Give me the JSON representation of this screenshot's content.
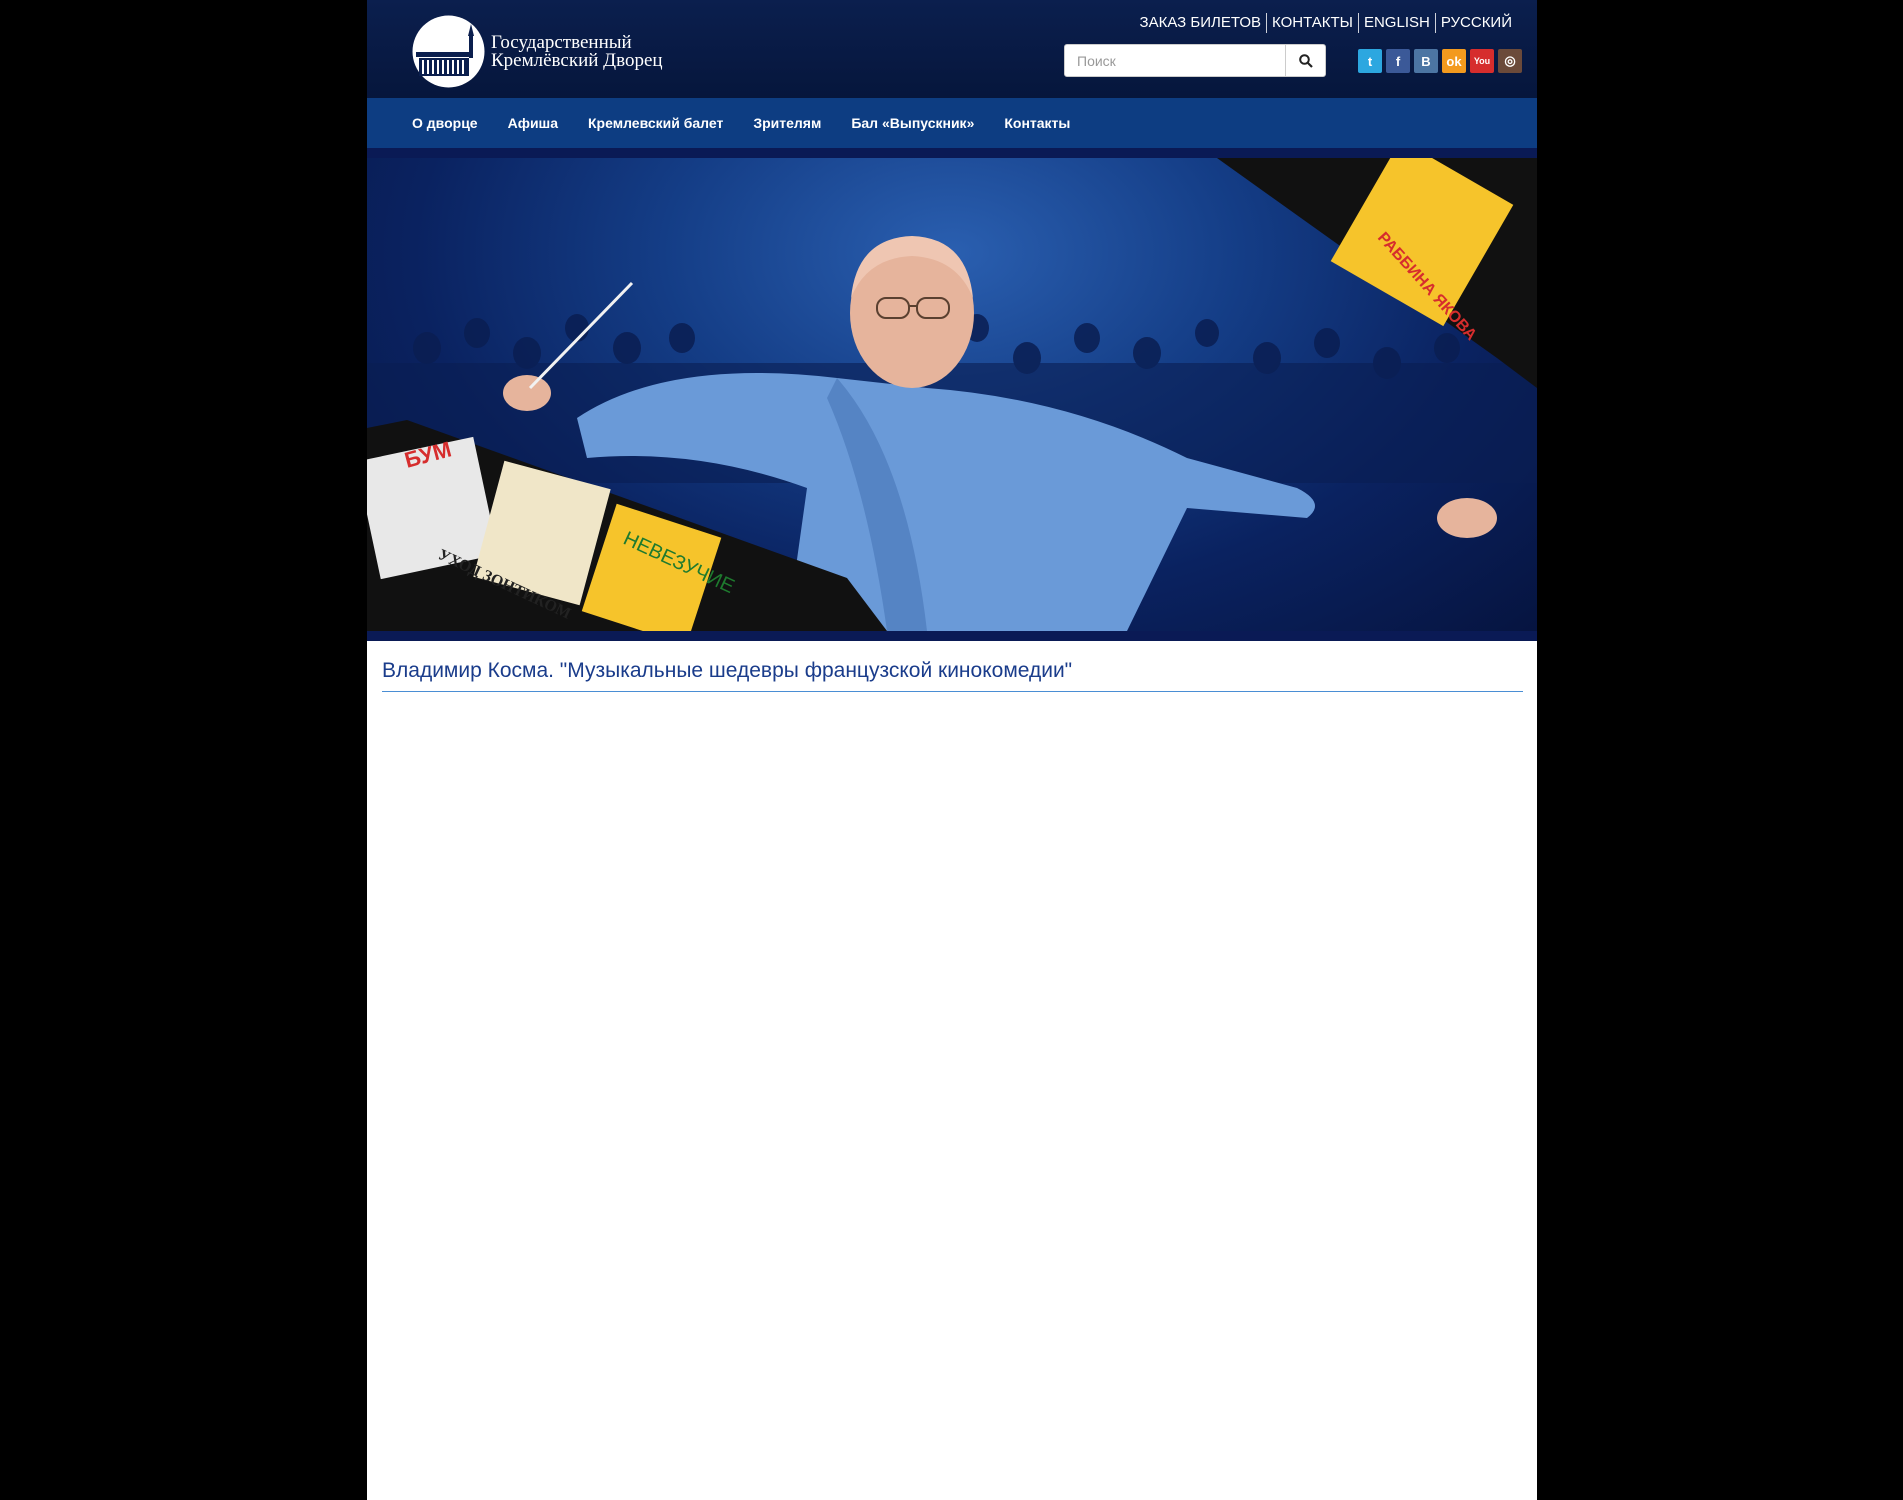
{
  "header": {
    "logo_line1": "Государственный",
    "logo_line2": "Кремлёвский Дворец",
    "top_links": [
      "ЗАКАЗ БИЛЕТОВ",
      "КОНТАКТЫ",
      "ENGLISH",
      "РУССКИЙ"
    ],
    "search": {
      "placeholder": "Поиск"
    },
    "social": [
      {
        "icon": "twitter-icon",
        "glyph": "t",
        "color": "#2ca7e0"
      },
      {
        "icon": "facebook-icon",
        "glyph": "f",
        "color": "#3b5998"
      },
      {
        "icon": "vk-icon",
        "glyph": "B",
        "color": "#4c75a3"
      },
      {
        "icon": "odnoklassniki-icon",
        "glyph": "ok",
        "color": "#f39a1e"
      },
      {
        "icon": "youtube-icon",
        "glyph": "You",
        "color": "#d62d2d"
      },
      {
        "icon": "instagram-icon",
        "glyph": "◎",
        "color": "#6b4a3a"
      }
    ]
  },
  "nav": {
    "items": [
      "О дворце",
      "Афиша",
      "Кремлевский балет",
      "Зрителям",
      "Бал «Выпускник»",
      "Контакты"
    ]
  },
  "banner": {
    "poster_labels": [
      "БУМ",
      "УХОД ЗОНТИКОМ",
      "НЕВЕЗУЧИЕ",
      "РАББИНА ЯКОВА"
    ]
  },
  "content": {
    "title": "Владимир Косма. \"Музыкальные шедевры французской кинокомедии\""
  }
}
